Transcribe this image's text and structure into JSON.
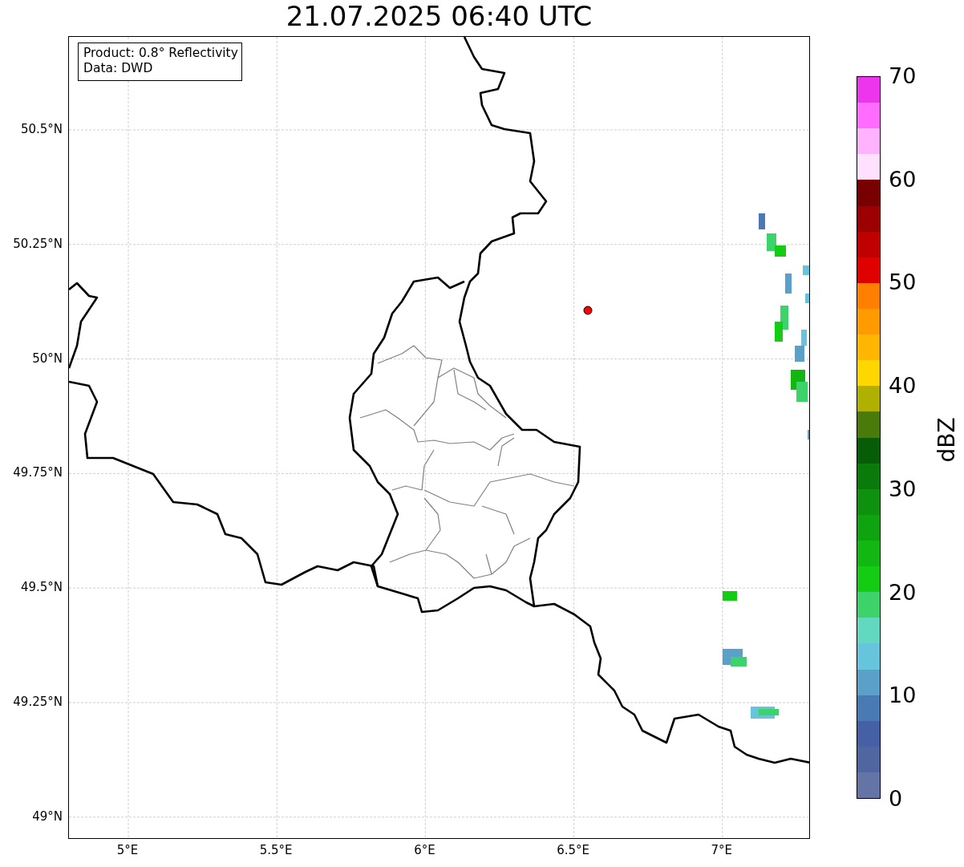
{
  "title": "21.07.2025 06:40 UTC",
  "info_box": {
    "lines": [
      "Product: 0.8° Reflectivity",
      "Data: DWD"
    ]
  },
  "map": {
    "lat_labels": [
      "50.5°N",
      "50.25°N",
      "50°N",
      "49.75°N",
      "49.5°N",
      "49.25°N",
      "49°N"
    ],
    "lon_labels": [
      "5°E",
      "5.5°E",
      "6°E",
      "6.5°E",
      "7°E"
    ]
  },
  "colorbar": {
    "label": "dBZ",
    "ticks": [
      "70",
      "60",
      "50",
      "40",
      "30",
      "20",
      "10",
      "0"
    ],
    "bins": [
      {
        "color": "#6474a6"
      },
      {
        "color": "#5066a0"
      },
      {
        "color": "#4560a4"
      },
      {
        "color": "#4a7ab4"
      },
      {
        "color": "#5aa0c8"
      },
      {
        "color": "#66c4dc"
      },
      {
        "color": "#62d8c0"
      },
      {
        "color": "#3ed36a"
      },
      {
        "color": "#14cc14"
      },
      {
        "color": "#12b712"
      },
      {
        "color": "#10a310"
      },
      {
        "color": "#0e910e"
      },
      {
        "color": "#0a7a0a"
      },
      {
        "color": "#075d07"
      },
      {
        "color": "#4a7a0a"
      },
      {
        "color": "#b0b000"
      },
      {
        "color": "#ffd700"
      },
      {
        "color": "#ffb600"
      },
      {
        "color": "#ff9a00"
      },
      {
        "color": "#ff7f00"
      },
      {
        "color": "#e00000"
      },
      {
        "color": "#c00000"
      },
      {
        "color": "#9c0000"
      },
      {
        "color": "#780000"
      },
      {
        "color": "#ffe0ff"
      },
      {
        "color": "#ffb3ff"
      },
      {
        "color": "#ff6cff"
      },
      {
        "color": "#ee35ee"
      }
    ]
  }
}
